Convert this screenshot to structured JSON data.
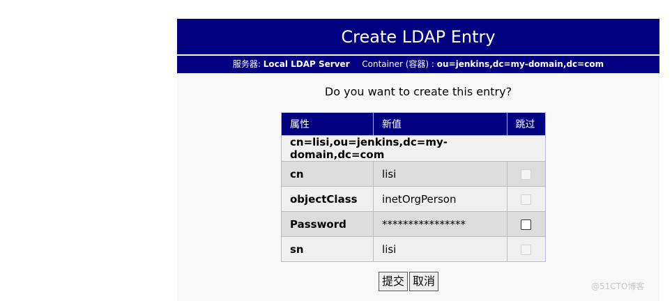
{
  "header": {
    "title": "Create LDAP Entry",
    "server_label": "服务器:",
    "server_value": "Local LDAP Server",
    "container_label": "Container (容器) :",
    "container_value": "ou=jenkins,dc=my-domain,dc=com"
  },
  "prompt": "Do you want to create this entry?",
  "table": {
    "headers": [
      "属性",
      "新值",
      "跳过"
    ],
    "dn": "cn=lisi,ou=jenkins,dc=my-domain,dc=com",
    "rows": [
      {
        "attr": "cn",
        "value": "lisi"
      },
      {
        "attr": "objectClass",
        "value": "inetOrgPerson"
      },
      {
        "attr": "Password",
        "value": "****************"
      },
      {
        "attr": "sn",
        "value": "lisi"
      }
    ]
  },
  "buttons": {
    "submit": "提交",
    "cancel": "取消"
  },
  "watermark": "@51CTO博客"
}
